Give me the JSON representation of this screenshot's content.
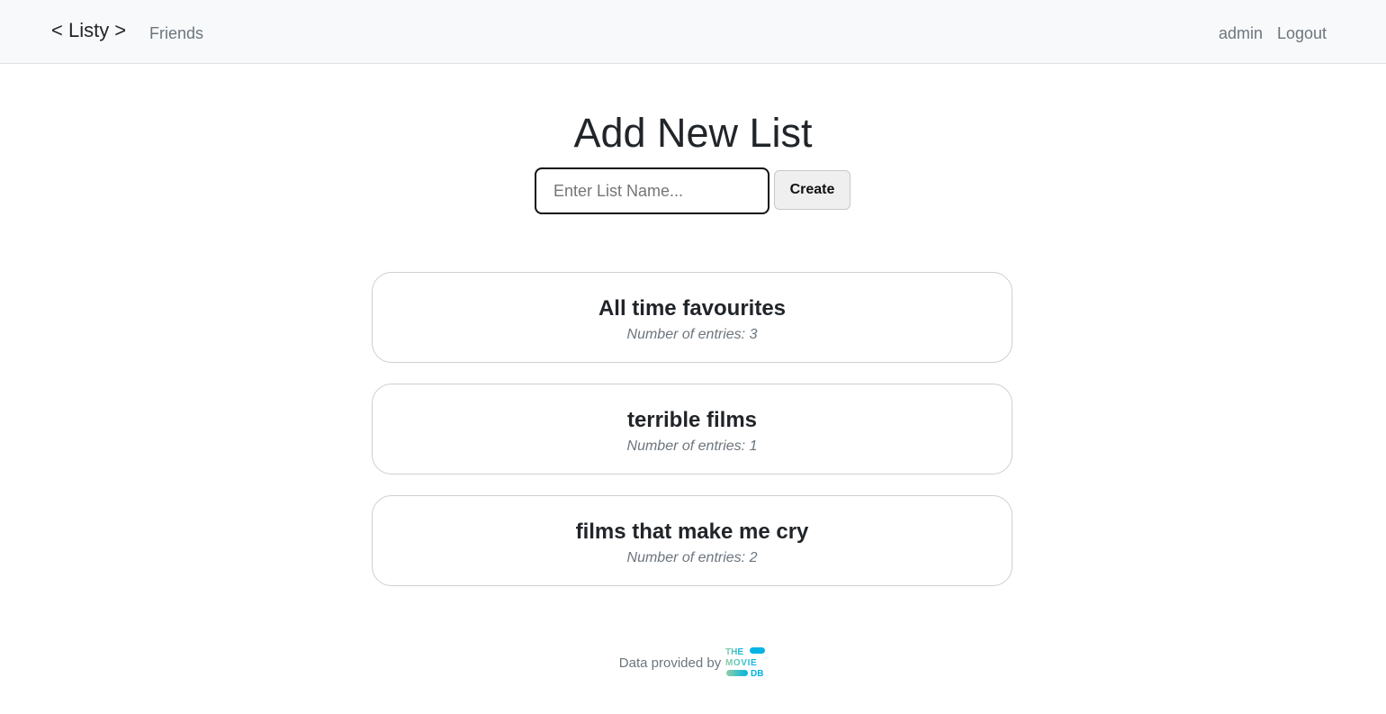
{
  "navbar": {
    "brand": "< Listy >",
    "friends_label": "Friends",
    "user_label": "admin",
    "logout_label": "Logout"
  },
  "main": {
    "title": "Add New List",
    "input_placeholder": "Enter List Name...",
    "input_value": "",
    "create_label": "Create"
  },
  "lists": [
    {
      "name": "All time favourites",
      "entries_text": "Number of entries: 3"
    },
    {
      "name": "terrible films",
      "entries_text": "Number of entries: 1"
    },
    {
      "name": "films that make me cry",
      "entries_text": "Number of entries: 2"
    }
  ],
  "footer": {
    "text": "Data provided by",
    "logo_text": "THE MOVIE DB",
    "logo_icon": "tmdb-logo-icon"
  },
  "colors": {
    "navbar_bg": "#f8f9fa",
    "muted_text": "#6c757d",
    "logo_gradient_start": "#90cea1",
    "logo_gradient_end": "#01b4e4"
  }
}
